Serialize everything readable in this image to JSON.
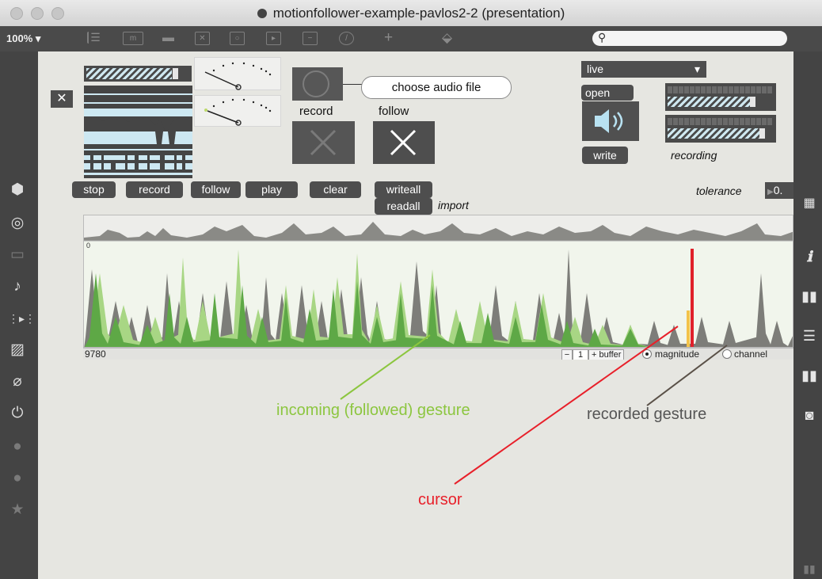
{
  "window": {
    "title": "motionfollower-example-pavlos2-2 (presentation)",
    "zoom": "100%"
  },
  "toolbar": {
    "icons": [
      "presentation-list-icon",
      "message-icon",
      "comment-icon",
      "toggle-icon",
      "button-icon",
      "playbar-icon",
      "slider-icon",
      "dial-icon",
      "plus-icon",
      "eraser-icon"
    ],
    "search_placeholder": ""
  },
  "patch": {
    "close_glyph": "✕",
    "choose_audio_label": "choose audio file",
    "record_label": "record",
    "follow_label": "follow",
    "buttons": {
      "stop": "stop",
      "record": "record",
      "follow": "follow",
      "play": "play",
      "clear": "clear",
      "writeall": "writeall",
      "readall": "readall",
      "open": "open",
      "write": "write"
    },
    "import_label": "import",
    "live_menu": {
      "selected": "live"
    },
    "recording_label": "recording",
    "tolerance_label": "tolerance",
    "tolerance_value": "0.",
    "waveform": {
      "zero_label": "0",
      "sample_label": "9780",
      "buffer_step_value": "1",
      "buffer_label": "+ buffer",
      "magnitude_label": "magnitude",
      "channel_label": "channel",
      "mode": "magnitude"
    }
  },
  "annotations": {
    "incoming": {
      "text": "incoming (followed) gesture",
      "color": "#8cc63f"
    },
    "recorded": {
      "text": "recorded gesture",
      "color": "#555555"
    },
    "cursor": {
      "text": "cursor",
      "color": "#e8202a"
    }
  },
  "colors": {
    "recorded_fill": "#7d7d79",
    "incoming_fill": "#5ea846",
    "incoming_light": "#a8d684",
    "cursor": "#e0202a",
    "canvas_bg": "#f1f5ec"
  }
}
